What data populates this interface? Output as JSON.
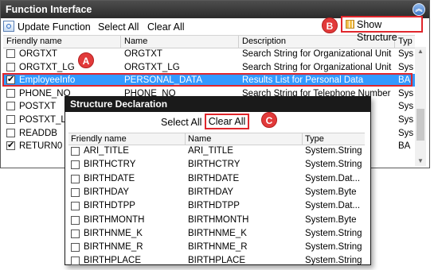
{
  "window": {
    "title": "Function Interface",
    "collapse_icon": "double-chevron-up-icon",
    "accent": "#3399ff"
  },
  "toolbar": {
    "update_label": "Update Function",
    "select_all_label": "Select All",
    "clear_all_label": "Clear All",
    "show_structure_label": "Show Structure"
  },
  "grid": {
    "columns": [
      "Friendly name",
      "Name",
      "Description",
      "Typ"
    ],
    "rows": [
      {
        "checked": false,
        "friendly": "ORGTXT",
        "name": "ORGTXT",
        "desc": "Search String for Organizational Unit",
        "type": "Sys"
      },
      {
        "checked": false,
        "friendly": "ORGTXT_LG",
        "name": "ORGTXT_LG",
        "desc": "Search String for Organizational Unit (l...",
        "type": "Sys"
      },
      {
        "checked": true,
        "friendly": "EmployeeInfo",
        "name": "PERSONAL_DATA",
        "desc": "Results List for Personal Data",
        "type": "BA"
      },
      {
        "checked": false,
        "friendly": "PHONE_NO",
        "name": "PHONE_NO",
        "desc": "Search String for Telephone Number",
        "type": "Sys"
      },
      {
        "checked": false,
        "friendly": "POSTXT",
        "name": "",
        "desc": "",
        "type": "Sys"
      },
      {
        "checked": false,
        "friendly": "POSTXT_LG",
        "name": "",
        "desc": "",
        "type": "Sys"
      },
      {
        "checked": false,
        "friendly": "READDB",
        "name": "",
        "desc": "",
        "type": "Sys"
      },
      {
        "checked": true,
        "friendly": "RETURN0",
        "name": "",
        "desc": "",
        "type": "BA"
      }
    ],
    "selected_index": 2
  },
  "callouts": {
    "a": "A",
    "b": "B",
    "c": "C",
    "color": "#e23a3a"
  },
  "dialog": {
    "title": "Structure Declaration",
    "select_all_label": "Select All",
    "clear_all_label": "Clear All",
    "columns": [
      "Friendly name",
      "Name",
      "Type"
    ],
    "rows": [
      {
        "checked": false,
        "friendly": "ARI_TITLE",
        "name": "ARI_TITLE",
        "type": "System.String"
      },
      {
        "checked": false,
        "friendly": "BIRTHCTRY",
        "name": "BIRTHCTRY",
        "type": "System.String"
      },
      {
        "checked": false,
        "friendly": "BIRTHDATE",
        "name": "BIRTHDATE",
        "type": "System.Dat..."
      },
      {
        "checked": false,
        "friendly": "BIRTHDAY",
        "name": "BIRTHDAY",
        "type": "System.Byte"
      },
      {
        "checked": false,
        "friendly": "BIRTHDTPP",
        "name": "BIRTHDTPP",
        "type": "System.Dat..."
      },
      {
        "checked": false,
        "friendly": "BIRTHMONTH",
        "name": "BIRTHMONTH",
        "type": "System.Byte"
      },
      {
        "checked": false,
        "friendly": "BIRTHNME_K",
        "name": "BIRTHNME_K",
        "type": "System.String"
      },
      {
        "checked": false,
        "friendly": "BIRTHNME_R",
        "name": "BIRTHNME_R",
        "type": "System.String"
      },
      {
        "checked": false,
        "friendly": "BIRTHPLACE",
        "name": "BIRTHPLACE",
        "type": "System.String"
      }
    ]
  }
}
